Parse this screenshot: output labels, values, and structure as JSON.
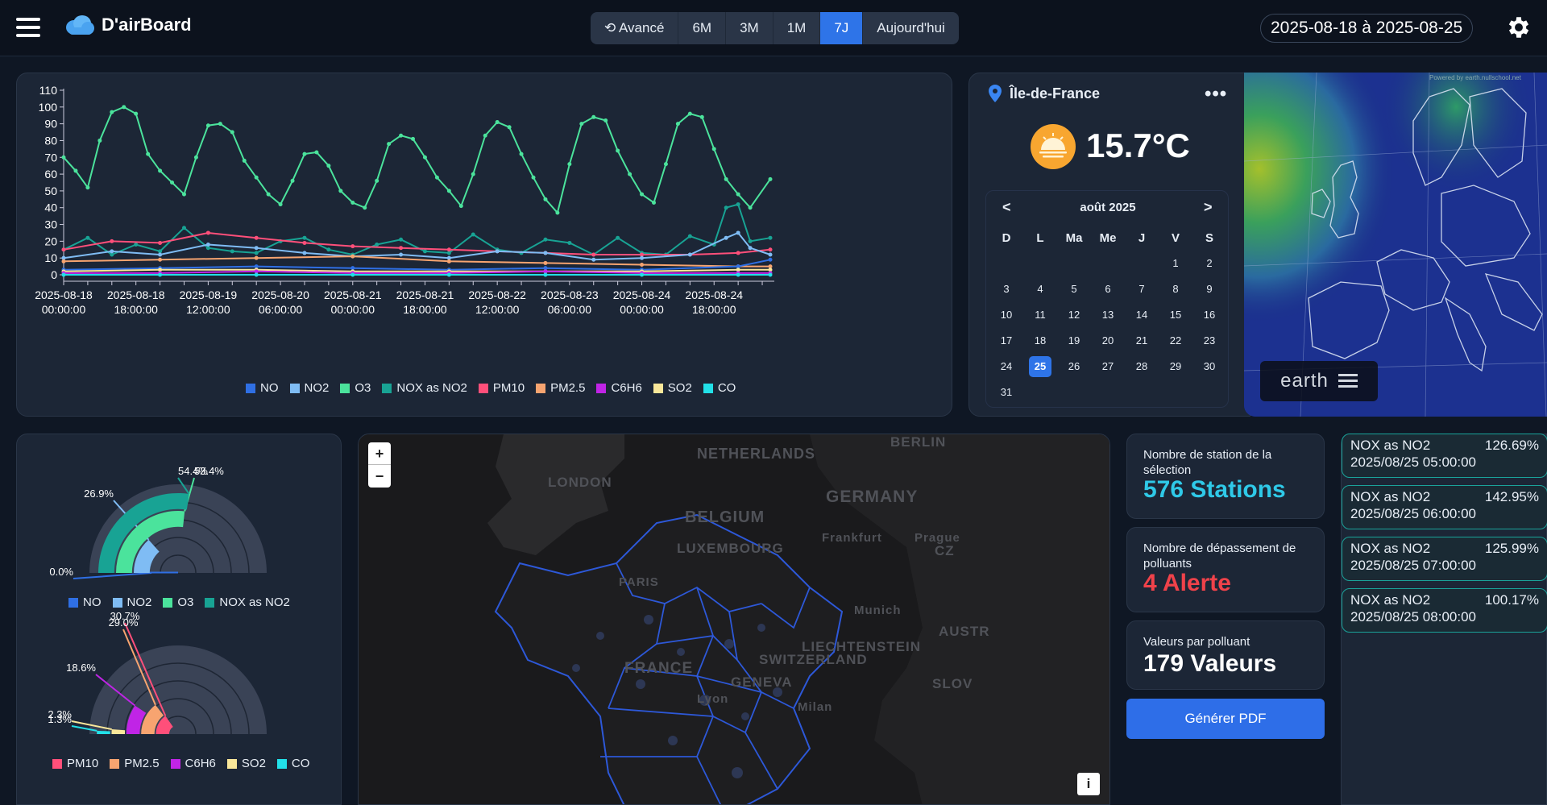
{
  "app": {
    "title": "D'airBoard"
  },
  "toolbar": {
    "ranges": [
      {
        "label": "⟲ Avancé",
        "active": false
      },
      {
        "label": "6M",
        "active": false
      },
      {
        "label": "3M",
        "active": false
      },
      {
        "label": "1M",
        "active": false
      },
      {
        "label": "7J",
        "active": true
      },
      {
        "label": "Aujourd'hui",
        "active": false
      }
    ],
    "date_range": "2025-08-18 à 2025-08-25"
  },
  "colors": {
    "NO": "#2f6fe4",
    "NO2": "#7fbcf4",
    "O3": "#4be39c",
    "NOX as NO2": "#18a394",
    "PM10": "#ff4f7a",
    "PM2.5": "#f7a470",
    "C6H6": "#c024e6",
    "SO2": "#f9e79a",
    "CO": "#22e0e8"
  },
  "chart_data": [
    {
      "type": "line",
      "xlim": [
        "2025-08-18 00:00:00",
        "2025-08-25 08:00:00"
      ],
      "ylim": [
        0,
        110
      ],
      "yticks": [
        "110",
        "100",
        "90",
        "80",
        "70",
        "60",
        "50",
        "40",
        "30",
        "20",
        "10",
        "0"
      ],
      "xticks": [
        [
          "2025-08-18",
          "00:00:00"
        ],
        [
          "2025-08-18",
          "18:00:00"
        ],
        [
          "2025-08-19",
          "12:00:00"
        ],
        [
          "2025-08-20",
          "06:00:00"
        ],
        [
          "2025-08-21",
          "00:00:00"
        ],
        [
          "2025-08-21",
          "18:00:00"
        ],
        [
          "2025-08-22",
          "12:00:00"
        ],
        [
          "2025-08-23",
          "06:00:00"
        ],
        [
          "2025-08-24",
          "00:00:00"
        ],
        [
          "2025-08-24",
          "18:00:00"
        ]
      ],
      "legend": [
        "NO",
        "NO2",
        "O3",
        "NOX as NO2",
        "PM10",
        "PM2.5",
        "C6H6",
        "SO2",
        "CO"
      ],
      "series": [
        {
          "name": "O3",
          "x_hours": [
            0,
            3,
            6,
            9,
            12,
            15,
            18,
            21,
            24,
            27,
            30,
            33,
            36,
            39,
            42,
            45,
            48,
            51,
            54,
            57,
            60,
            63,
            66,
            69,
            72,
            75,
            78,
            81,
            84,
            87,
            90,
            93,
            96,
            99,
            102,
            105,
            108,
            111,
            114,
            117,
            120,
            123,
            126,
            129,
            132,
            135,
            138,
            141,
            144,
            147,
            150,
            153,
            156,
            159,
            162,
            165,
            168,
            171,
            176
          ],
          "values": [
            70,
            62,
            52,
            80,
            97,
            100,
            96,
            72,
            62,
            55,
            48,
            70,
            89,
            90,
            85,
            68,
            58,
            48,
            42,
            56,
            72,
            73,
            65,
            50,
            43,
            40,
            56,
            78,
            83,
            81,
            70,
            58,
            50,
            41,
            60,
            83,
            91,
            88,
            72,
            58,
            45,
            37,
            66,
            90,
            94,
            92,
            74,
            60,
            48,
            43,
            66,
            90,
            96,
            94,
            75,
            57,
            48,
            40,
            57
          ]
        },
        {
          "name": "NOX as NO2",
          "x_hours": [
            0,
            6,
            12,
            18,
            24,
            30,
            36,
            42,
            48,
            54,
            60,
            66,
            72,
            78,
            84,
            90,
            96,
            102,
            108,
            114,
            120,
            126,
            132,
            138,
            144,
            150,
            156,
            162,
            165,
            168,
            171,
            176
          ],
          "values": [
            15,
            22,
            12,
            18,
            14,
            28,
            16,
            14,
            13,
            20,
            22,
            15,
            12,
            18,
            21,
            14,
            13,
            24,
            15,
            13,
            21,
            19,
            12,
            22,
            13,
            12,
            23,
            18,
            40,
            42,
            20,
            22
          ]
        },
        {
          "name": "PM10",
          "x_hours": [
            0,
            12,
            24,
            36,
            48,
            60,
            72,
            84,
            96,
            108,
            120,
            132,
            144,
            156,
            168,
            176
          ],
          "values": [
            15,
            20,
            19,
            25,
            22,
            19,
            17,
            16,
            15,
            14,
            13,
            12,
            12,
            12,
            13,
            15
          ]
        },
        {
          "name": "NO2",
          "x_hours": [
            0,
            12,
            24,
            36,
            48,
            60,
            72,
            84,
            96,
            108,
            120,
            132,
            144,
            156,
            165,
            168,
            171,
            176
          ],
          "values": [
            10,
            14,
            12,
            18,
            16,
            13,
            11,
            12,
            10,
            14,
            13,
            9,
            10,
            12,
            22,
            25,
            16,
            12
          ]
        },
        {
          "name": "PM2.5",
          "x_hours": [
            0,
            24,
            48,
            72,
            96,
            120,
            144,
            168,
            176
          ],
          "values": [
            8,
            9,
            10,
            11,
            8,
            7,
            6,
            5,
            5
          ]
        },
        {
          "name": "NO",
          "x_hours": [
            0,
            24,
            48,
            72,
            96,
            120,
            144,
            168,
            176
          ],
          "values": [
            3,
            4,
            5,
            4,
            3,
            4,
            3,
            5,
            9
          ]
        },
        {
          "name": "SO2",
          "x_hours": [
            0,
            24,
            48,
            72,
            96,
            120,
            144,
            168,
            176
          ],
          "values": [
            2,
            3,
            3,
            2,
            2,
            2,
            2,
            3,
            3
          ]
        },
        {
          "name": "C6H6",
          "x_hours": [
            0,
            24,
            48,
            72,
            96,
            120,
            144,
            168,
            176
          ],
          "values": [
            1,
            1,
            2,
            1,
            1,
            2,
            1,
            1,
            1
          ]
        },
        {
          "name": "CO",
          "x_hours": [
            0,
            24,
            48,
            72,
            96,
            120,
            144,
            168,
            176
          ],
          "values": [
            0,
            0,
            0,
            0,
            0,
            0,
            0,
            0,
            0
          ]
        }
      ]
    },
    {
      "type": "bar",
      "polar": true,
      "categories": [
        "NO",
        "NO2",
        "O3",
        "NOX as NO2"
      ],
      "values": [
        0.0,
        26.9,
        53.4,
        54.4
      ],
      "labels": [
        "0.0%",
        "26.9%",
        "53.4%",
        "54.4%"
      ]
    },
    {
      "type": "bar",
      "polar": true,
      "categories": [
        "PM10",
        "PM2.5",
        "C6H6",
        "SO2",
        "CO"
      ],
      "values": [
        30.7,
        29.0,
        18.6,
        2.3,
        1.3
      ],
      "labels": [
        "30.7%",
        "29.0%",
        "18.6%",
        "2.3%",
        "1.3%"
      ]
    }
  ],
  "weather": {
    "location": "Île-de-France",
    "temperature": "15.7°C",
    "menu": "•••"
  },
  "calendar": {
    "month": "août 2025",
    "prev": "<",
    "next": ">",
    "dow": [
      "D",
      "L",
      "Ma",
      "Me",
      "J",
      "V",
      "S"
    ],
    "first_offset": 5,
    "days_in_month": 31,
    "selected": 25
  },
  "earth": {
    "label": "earth",
    "credit": "Powered by earth.nullschool.net"
  },
  "map": {
    "zoom_in": "+",
    "zoom_out": "−",
    "info": "i",
    "labels": [
      "NETHERLANDS",
      "BERLIN",
      "LONDON",
      "GERMANY",
      "BELGIUM",
      "Frankfurt",
      "Prague",
      "LUXEMBOURG",
      "CZ",
      "PARIS",
      "Munich",
      "AUSTR",
      "LIECHTENSTEIN",
      "SWITZERLAND",
      "FRANCE",
      "GENEVA",
      "Lyon",
      "Milan",
      "SLOV"
    ]
  },
  "stats": [
    {
      "title": "Nombre de station de la sélection",
      "value": "576 Stations",
      "color": "#2fc9e8"
    },
    {
      "title": "Nombre de dépassement de polluants",
      "value": "4 Alerte",
      "color": "#f0424a"
    },
    {
      "title": "Valeurs par polluant",
      "value": "179 Valeurs",
      "color": "#ffffff"
    }
  ],
  "pdf_label": "Générer PDF",
  "alerts": [
    {
      "name": "NOX as NO2",
      "percent": "126.69%",
      "date": "2025/08/25 05:00:00"
    },
    {
      "name": "NOX as NO2",
      "percent": "142.95%",
      "date": "2025/08/25 06:00:00"
    },
    {
      "name": "NOX as NO2",
      "percent": "125.99%",
      "date": "2025/08/25 07:00:00"
    },
    {
      "name": "NOX as NO2",
      "percent": "100.17%",
      "date": "2025/08/25 08:00:00"
    }
  ]
}
